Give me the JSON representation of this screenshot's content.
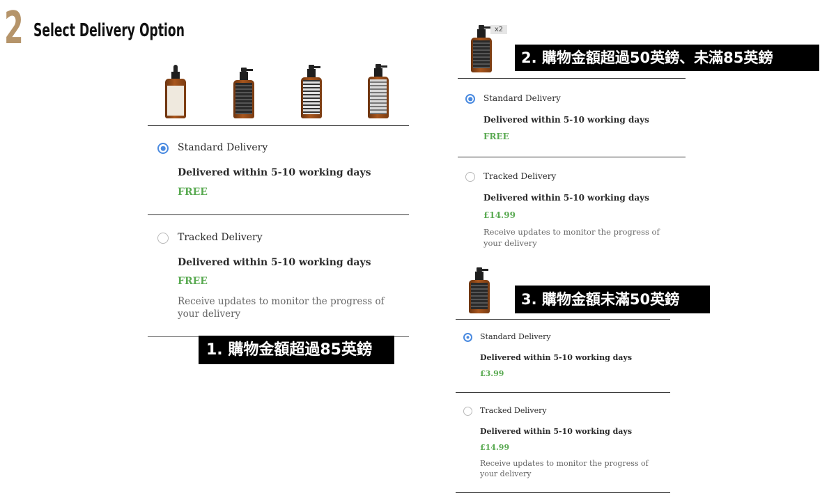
{
  "header": {
    "step_number": "2",
    "title": "Select Delivery Option"
  },
  "panel1": {
    "tag": "1. 購物金額超過85英鎊",
    "options": [
      {
        "name": "Standard Delivery",
        "days": "Delivered within 5-10 working days",
        "price": "FREE",
        "selected": true
      },
      {
        "name": "Tracked Delivery",
        "days": "Delivered within 5-10 working days",
        "price": "FREE",
        "note": "Receive updates to monitor the progress of your delivery",
        "selected": false
      }
    ]
  },
  "panel2": {
    "tag": "2. 購物金額超過50英鎊、未滿85英鎊",
    "quantity": "x2",
    "options": [
      {
        "name": "Standard Delivery",
        "days": "Delivered within 5-10 working days",
        "price": "FREE",
        "selected": true
      },
      {
        "name": "Tracked Delivery",
        "days": "Delivered within 5-10 working days",
        "price": "£14.99",
        "note": "Receive updates to monitor the progress of your delivery",
        "selected": false
      }
    ]
  },
  "panel3": {
    "tag": "3. 購物金額未滿50英鎊",
    "options": [
      {
        "name": "Standard Delivery",
        "days": "Delivered within 5-10 working days",
        "price": "£3.99",
        "selected": true
      },
      {
        "name": "Tracked Delivery",
        "days": "Delivered within 5-10 working days",
        "price": "£14.99",
        "note": "Receive updates to monitor the progress of your delivery",
        "selected": false
      }
    ]
  },
  "colors": {
    "accent": "#4a8ae0",
    "price_green": "#5aaa52",
    "step_number": "#b5946a"
  }
}
